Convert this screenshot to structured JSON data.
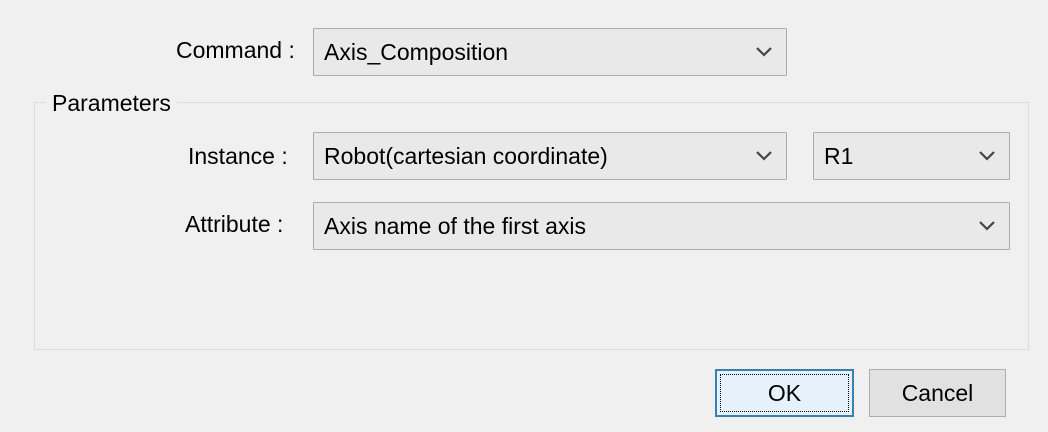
{
  "command": {
    "label": "Command :",
    "value": "Axis_Composition"
  },
  "parameters": {
    "legend": "Parameters",
    "instance": {
      "label": "Instance :",
      "value": "Robot(cartesian coordinate)",
      "sub_value": "R1"
    },
    "attribute": {
      "label": "Attribute :",
      "value": "Axis name of the first axis"
    }
  },
  "buttons": {
    "ok": "OK",
    "cancel": "Cancel"
  },
  "icons": {
    "dropdown": "chevron-down-icon"
  },
  "colors": {
    "focus_border": "#3c7fb1",
    "dialog_background": "#f0f0f0"
  }
}
